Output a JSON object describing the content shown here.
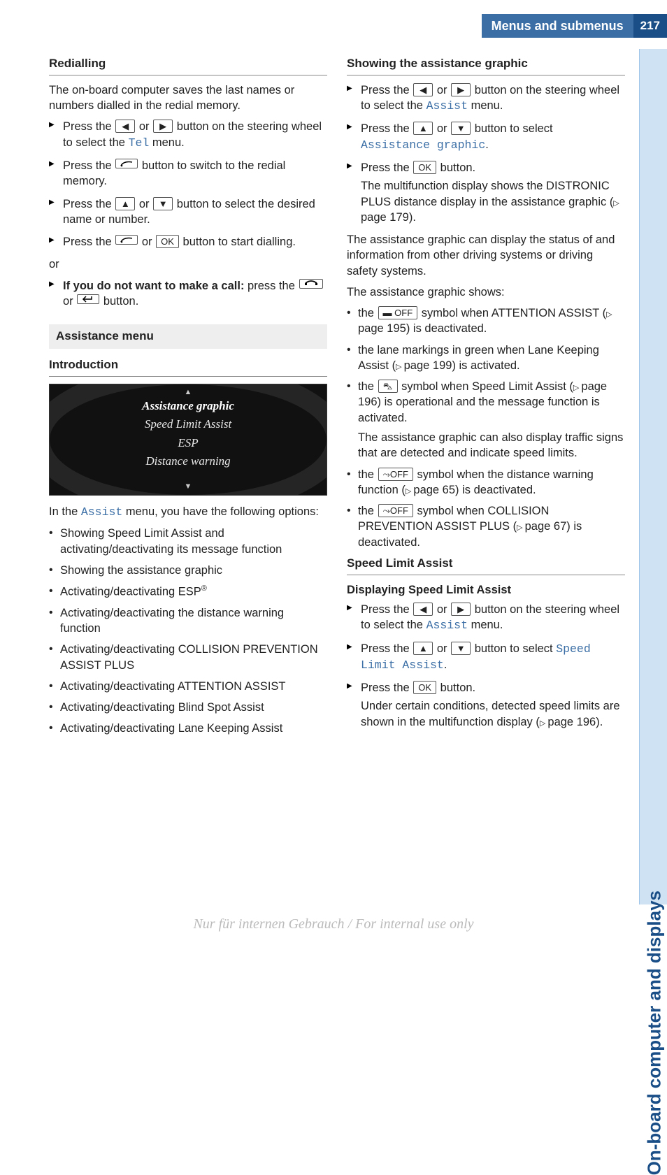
{
  "header": {
    "title": "Menus and submenus",
    "page_number": "217"
  },
  "side_tab": "On-board computer and displays",
  "footer_watermark": "Nur für internen Gebrauch / For internal use only",
  "buttons": {
    "left": "◀",
    "right": "▶",
    "up": "▲",
    "down": "▼",
    "ok": "OK",
    "off_icon": "▬ OFF",
    "car_sign": "⛍",
    "dist_off": "⤳OFF"
  },
  "left_col": {
    "redialling": {
      "heading": "Redialling",
      "intro": "The on-board computer saves the last names or numbers dialled in the redial memory.",
      "step1_a": "Press the ",
      "step1_b": " or ",
      "step1_c": " button on the steering wheel to select the ",
      "step1_menu": "Tel",
      "step1_d": " menu.",
      "step2_a": "Press the ",
      "step2_b": " button to switch to the redial memory.",
      "step3_a": "Press the ",
      "step3_b": " or ",
      "step3_c": " button to select the desired name or number.",
      "step4_a": "Press the ",
      "step4_b": " or ",
      "step4_c": " button to start dialling.",
      "or": "or",
      "step5_a": "If you do not want to make a call:",
      "step5_b": " press the ",
      "step5_c": " or ",
      "step5_d": " button."
    },
    "assistance": {
      "section_heading": "Assistance menu",
      "intro_heading": "Introduction",
      "screenshot_lines": [
        "Assistance graphic",
        "Speed Limit Assist",
        "ESP",
        "Distance warning"
      ],
      "intro_a": "In the ",
      "intro_menu": "Assist",
      "intro_b": " menu, you have the following options:",
      "opts": [
        "Showing Speed Limit Assist and activating/deactivating its message function",
        "Showing the assistance graphic",
        "Activating/deactivating ESP®",
        "Activating/deactivating the distance warning function",
        "Activating/deactivating COLLISION PREVENTION ASSIST PLUS",
        "Activating/deactivating ATTENTION ASSIST",
        "Activating/deactivating Blind Spot Assist",
        "Activating/deactivating Lane Keeping Assist"
      ]
    }
  },
  "right_col": {
    "showing": {
      "heading": "Showing the assistance graphic",
      "s1_a": "Press the ",
      "s1_b": " or ",
      "s1_c": " button on the steering wheel to select the ",
      "s1_menu": "Assist",
      "s1_d": " menu.",
      "s2_a": "Press the ",
      "s2_b": " or ",
      "s2_c": " button to select ",
      "s2_menu": "Assistance graphic",
      "s2_d": ".",
      "s3_a": "Press the ",
      "s3_b": " button.",
      "s3_sub": "The multifunction display shows the DISTRONIC PLUS distance display in the assistance graphic (",
      "s3_ref": "page 179",
      "s3_sub_end": ").",
      "para": "The assistance graphic can display the status of and information from other driving systems or driving safety systems.",
      "list_intro": "The assistance graphic shows:",
      "li1_a": "the ",
      "li1_b": " symbol when ATTENTION ASSIST (",
      "li1_ref": "page 195",
      "li1_c": ") is deactivated.",
      "li2_a": "the lane markings in green when Lane Keeping Assist (",
      "li2_ref": "page 199",
      "li2_b": ") is activated.",
      "li3_a": "the ",
      "li3_b": " symbol when Speed Limit Assist (",
      "li3_ref": "page 196",
      "li3_c": ") is operational and the message function is activated.",
      "li3_sub": "The assistance graphic can also display traffic signs that are detected and indicate speed limits.",
      "li4_a": "the ",
      "li4_b": " symbol when the distance warning function (",
      "li4_ref": "page 65",
      "li4_c": ") is deactivated.",
      "li5_a": "the ",
      "li5_b": " symbol when COLLISION PREVENTION ASSIST PLUS (",
      "li5_ref": "page 67",
      "li5_c": ") is deactivated."
    },
    "sla": {
      "heading": "Speed Limit Assist",
      "sub_heading": "Displaying Speed Limit Assist",
      "s1_a": "Press the ",
      "s1_b": " or ",
      "s1_c": " button on the steering wheel to select the ",
      "s1_menu": "Assist",
      "s1_d": " menu.",
      "s2_a": "Press the ",
      "s2_b": " or ",
      "s2_c": " button to select ",
      "s2_menu": "Speed Limit Assist",
      "s2_d": ".",
      "s3_a": "Press the ",
      "s3_b": " button.",
      "s3_sub": "Under certain conditions, detected speed limits are shown in the multifunction display (",
      "s3_ref": "page 196",
      "s3_sub_end": ")."
    }
  }
}
